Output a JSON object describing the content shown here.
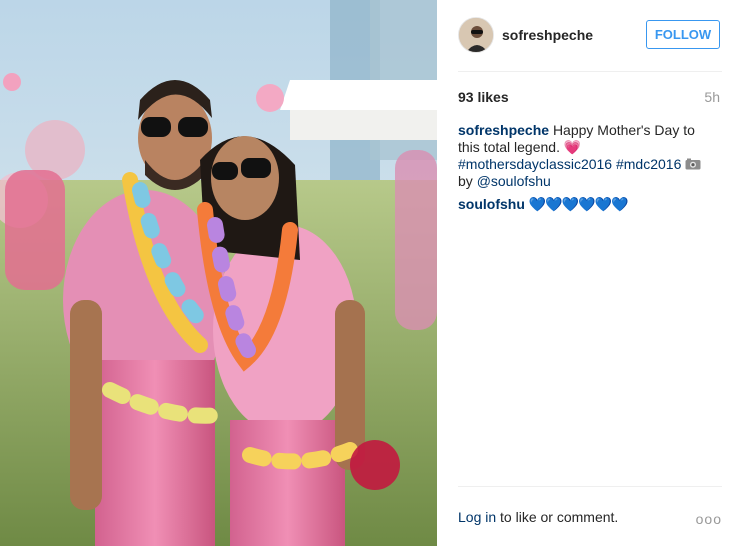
{
  "post": {
    "username": "sofreshpeche",
    "follow_label": "FOLLOW",
    "likes": "93 likes",
    "time": "5h"
  },
  "comments": [
    {
      "username": "sofreshpeche",
      "text_a": "Happy Mother's Day to this total legend.",
      "heart_emoji": "💗",
      "hashtag1": "#mothersdayclassic2016",
      "hashtag2": "#mdc2016",
      "camera_icon": "camera-icon",
      "by_text": "by",
      "mention": "@soulofshu"
    },
    {
      "username": "soulofshu",
      "text": "💙💙💙💙💙💙"
    }
  ],
  "footer": {
    "login_link": "Log in",
    "login_rest": " to like or comment.",
    "more_label": "ooo"
  },
  "colors": {
    "link_dark": "#003569",
    "follow_blue": "#3897f0",
    "muted": "#999999",
    "pink": "#ee5b9c"
  }
}
